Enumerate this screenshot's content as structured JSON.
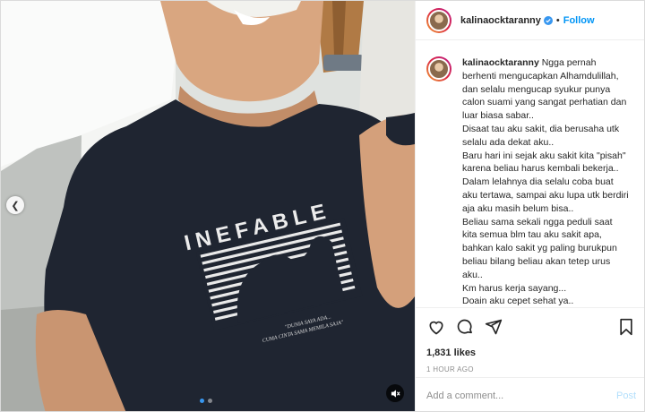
{
  "media": {
    "shirt_brand": "INEFABLE",
    "shirt_tagline_1": "\"DUNIA SAYA ADA...",
    "shirt_tagline_2": "CUMA CINTA SAMA MEMILA SAJA\"",
    "carousel": {
      "count": 2,
      "active_index": 0
    },
    "icons": {
      "prev": "chevron-left-icon",
      "mute": "speaker-muted-icon"
    }
  },
  "header": {
    "username": "kalinaocktaranny",
    "separator": "•",
    "follow_label": "Follow",
    "verified": true
  },
  "caption": {
    "username": "kalinaocktaranny",
    "lines": [
      "Ngga pernah berhenti mengucapkan Alhamdulillah, dan selalu mengucap syukur punya calon suami yang sangat perhatian dan luar biasa sabar..",
      "Disaat tau aku sakit, dia berusaha utk selalu ada dekat aku..",
      "Baru hari ini sejak aku sakit kita \"pisah\" karena beliau harus kembali bekerja..",
      "Dalam lelahnya dia selalu coba buat aku tertawa, sampai aku lupa utk berdiri aja aku masih belum bisa..",
      "Beliau sama sekali ngga peduli saat kita semua blm tau aku sakit apa, bahkan kalo sakit yg paling burukpun beliau bilang beliau akan tetep urus aku..",
      "Km harus kerja sayang...",
      "Doain aku cepet sehat ya.."
    ]
  },
  "actions": {
    "icons": [
      "heart-icon",
      "comment-icon",
      "share-icon",
      "bookmark-icon"
    ],
    "likes": "1,831 likes",
    "time": "1 HOUR AGO"
  },
  "comment": {
    "placeholder": "Add a comment...",
    "value": "",
    "post_label": "Post"
  },
  "colors": {
    "accent": "#0095f6",
    "post_disabled": "#b2dffc",
    "verified": "#3897f0",
    "shirt": "#1e2430",
    "muted_text": "#8e8e8e"
  }
}
